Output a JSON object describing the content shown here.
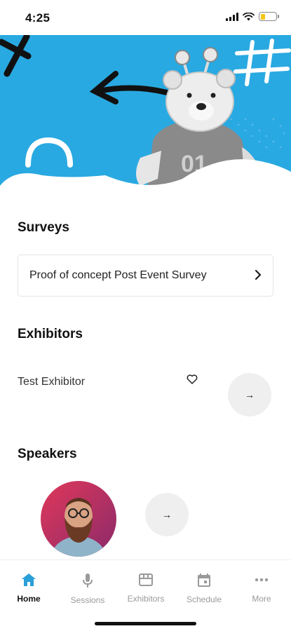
{
  "status_bar": {
    "time": "4:25",
    "battery_level": 0.25,
    "battery_color": "#f5c518"
  },
  "hero": {
    "background_color": "#29a9e1",
    "icon": "mascot-bear-banner"
  },
  "surveys": {
    "title": "Surveys",
    "items": [
      {
        "label": "Proof of concept Post Event Survey",
        "icon": "chevron-right-icon"
      }
    ]
  },
  "exhibitors": {
    "title": "Exhibitors",
    "items": [
      {
        "name": "Test Exhibitor",
        "favorite_icon": "heart-outline-icon"
      }
    ],
    "next_icon": "arrow-right-icon",
    "next_glyph": "→"
  },
  "speakers": {
    "title": "Speakers",
    "avatar_icon": "speaker-avatar",
    "next_icon": "arrow-right-icon",
    "next_glyph": "→"
  },
  "bottom_nav": {
    "accent_color": "#2a9fd8",
    "items": [
      {
        "label": "Home",
        "icon": "home-icon",
        "active": true
      },
      {
        "label": "Sessions",
        "icon": "microphone-icon",
        "active": false
      },
      {
        "label": "Exhibitors",
        "icon": "storefront-icon",
        "active": false
      },
      {
        "label": "Schedule",
        "icon": "calendar-icon",
        "active": false
      },
      {
        "label": "More",
        "icon": "more-dots-icon",
        "active": false
      }
    ]
  }
}
